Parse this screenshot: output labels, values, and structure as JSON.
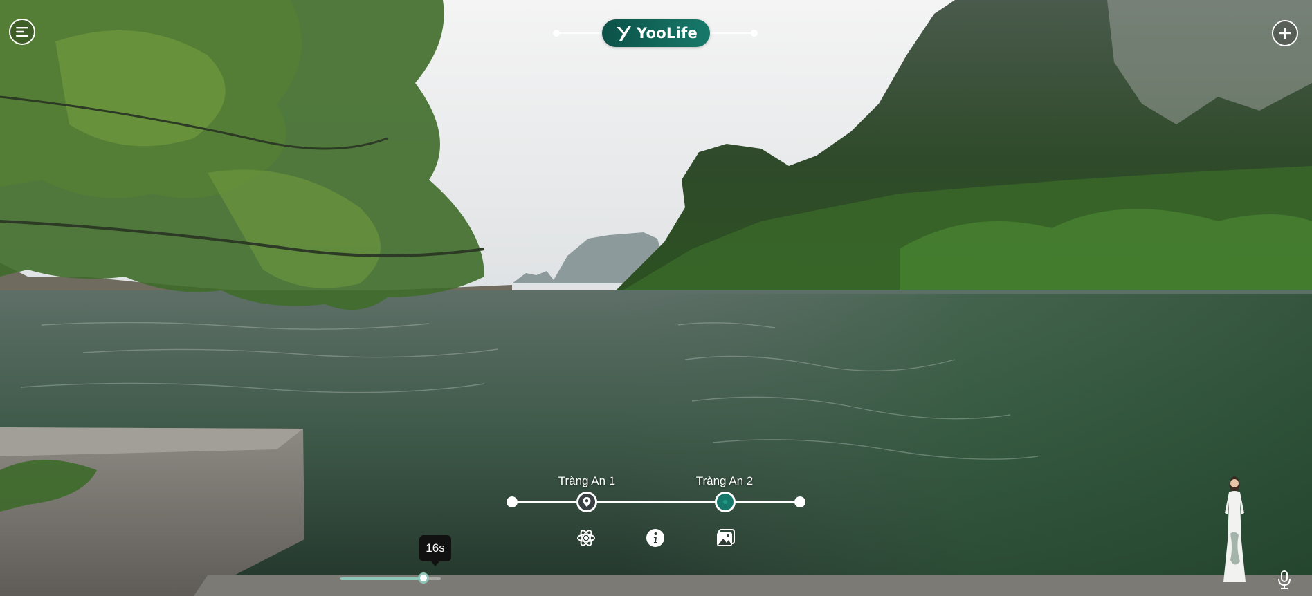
{
  "app": {
    "brand": "YooLife"
  },
  "header": {
    "menu_icon": "menu-icon",
    "add_icon": "plus-circle-icon"
  },
  "timeline": {
    "scenes": [
      {
        "label": "Tràng An 1",
        "icon": "map-pin-icon"
      },
      {
        "label": "Tràng An 2",
        "icon": "current-location-icon"
      }
    ]
  },
  "tools": [
    {
      "icon": "atom-icon"
    },
    {
      "icon": "info-icon"
    },
    {
      "icon": "gallery-icon"
    }
  ],
  "audio": {
    "time_label": "16s",
    "progress": 0.83
  },
  "colors": {
    "brand": "#16786b",
    "brand_dark": "#0c5148",
    "accent_light": "#8fc5b8"
  }
}
